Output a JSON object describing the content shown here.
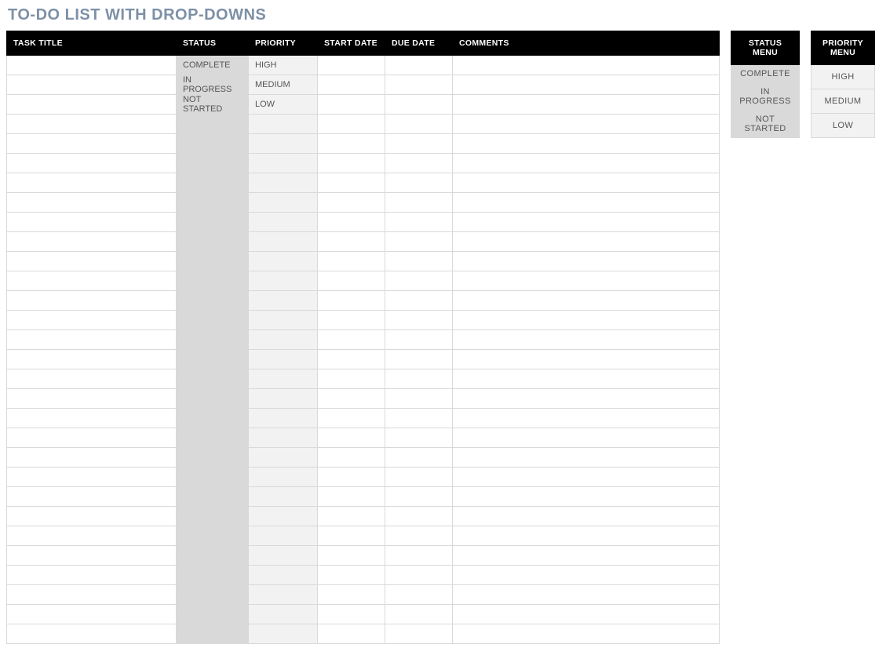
{
  "title": "TO-DO LIST WITH DROP-DOWNS",
  "columns": {
    "task": "TASK TITLE",
    "status": "STATUS",
    "priority": "PRIORITY",
    "start": "START DATE",
    "due": "DUE DATE",
    "comments": "COMMENTS"
  },
  "rows": [
    {
      "task": "",
      "status": "COMPLETE",
      "priority": "HIGH",
      "start": "",
      "due": "",
      "comments": ""
    },
    {
      "task": "",
      "status": "IN PROGRESS",
      "priority": "MEDIUM",
      "start": "",
      "due": "",
      "comments": ""
    },
    {
      "task": "",
      "status": "NOT STARTED",
      "priority": "LOW",
      "start": "",
      "due": "",
      "comments": ""
    },
    {
      "task": "",
      "status": "",
      "priority": "",
      "start": "",
      "due": "",
      "comments": ""
    },
    {
      "task": "",
      "status": "",
      "priority": "",
      "start": "",
      "due": "",
      "comments": ""
    },
    {
      "task": "",
      "status": "",
      "priority": "",
      "start": "",
      "due": "",
      "comments": ""
    },
    {
      "task": "",
      "status": "",
      "priority": "",
      "start": "",
      "due": "",
      "comments": ""
    },
    {
      "task": "",
      "status": "",
      "priority": "",
      "start": "",
      "due": "",
      "comments": ""
    },
    {
      "task": "",
      "status": "",
      "priority": "",
      "start": "",
      "due": "",
      "comments": ""
    },
    {
      "task": "",
      "status": "",
      "priority": "",
      "start": "",
      "due": "",
      "comments": ""
    },
    {
      "task": "",
      "status": "",
      "priority": "",
      "start": "",
      "due": "",
      "comments": ""
    },
    {
      "task": "",
      "status": "",
      "priority": "",
      "start": "",
      "due": "",
      "comments": ""
    },
    {
      "task": "",
      "status": "",
      "priority": "",
      "start": "",
      "due": "",
      "comments": ""
    },
    {
      "task": "",
      "status": "",
      "priority": "",
      "start": "",
      "due": "",
      "comments": ""
    },
    {
      "task": "",
      "status": "",
      "priority": "",
      "start": "",
      "due": "",
      "comments": ""
    },
    {
      "task": "",
      "status": "",
      "priority": "",
      "start": "",
      "due": "",
      "comments": ""
    },
    {
      "task": "",
      "status": "",
      "priority": "",
      "start": "",
      "due": "",
      "comments": ""
    },
    {
      "task": "",
      "status": "",
      "priority": "",
      "start": "",
      "due": "",
      "comments": ""
    },
    {
      "task": "",
      "status": "",
      "priority": "",
      "start": "",
      "due": "",
      "comments": ""
    },
    {
      "task": "",
      "status": "",
      "priority": "",
      "start": "",
      "due": "",
      "comments": ""
    },
    {
      "task": "",
      "status": "",
      "priority": "",
      "start": "",
      "due": "",
      "comments": ""
    },
    {
      "task": "",
      "status": "",
      "priority": "",
      "start": "",
      "due": "",
      "comments": ""
    },
    {
      "task": "",
      "status": "",
      "priority": "",
      "start": "",
      "due": "",
      "comments": ""
    },
    {
      "task": "",
      "status": "",
      "priority": "",
      "start": "",
      "due": "",
      "comments": ""
    },
    {
      "task": "",
      "status": "",
      "priority": "",
      "start": "",
      "due": "",
      "comments": ""
    },
    {
      "task": "",
      "status": "",
      "priority": "",
      "start": "",
      "due": "",
      "comments": ""
    },
    {
      "task": "",
      "status": "",
      "priority": "",
      "start": "",
      "due": "",
      "comments": ""
    },
    {
      "task": "",
      "status": "",
      "priority": "",
      "start": "",
      "due": "",
      "comments": ""
    },
    {
      "task": "",
      "status": "",
      "priority": "",
      "start": "",
      "due": "",
      "comments": ""
    },
    {
      "task": "",
      "status": "",
      "priority": "",
      "start": "",
      "due": "",
      "comments": ""
    }
  ],
  "status_menu": {
    "header": "STATUS MENU",
    "options": [
      "COMPLETE",
      "IN PROGRESS",
      "NOT STARTED"
    ]
  },
  "priority_menu": {
    "header": "PRIORITY MENU",
    "options": [
      "HIGH",
      "MEDIUM",
      "LOW"
    ]
  }
}
